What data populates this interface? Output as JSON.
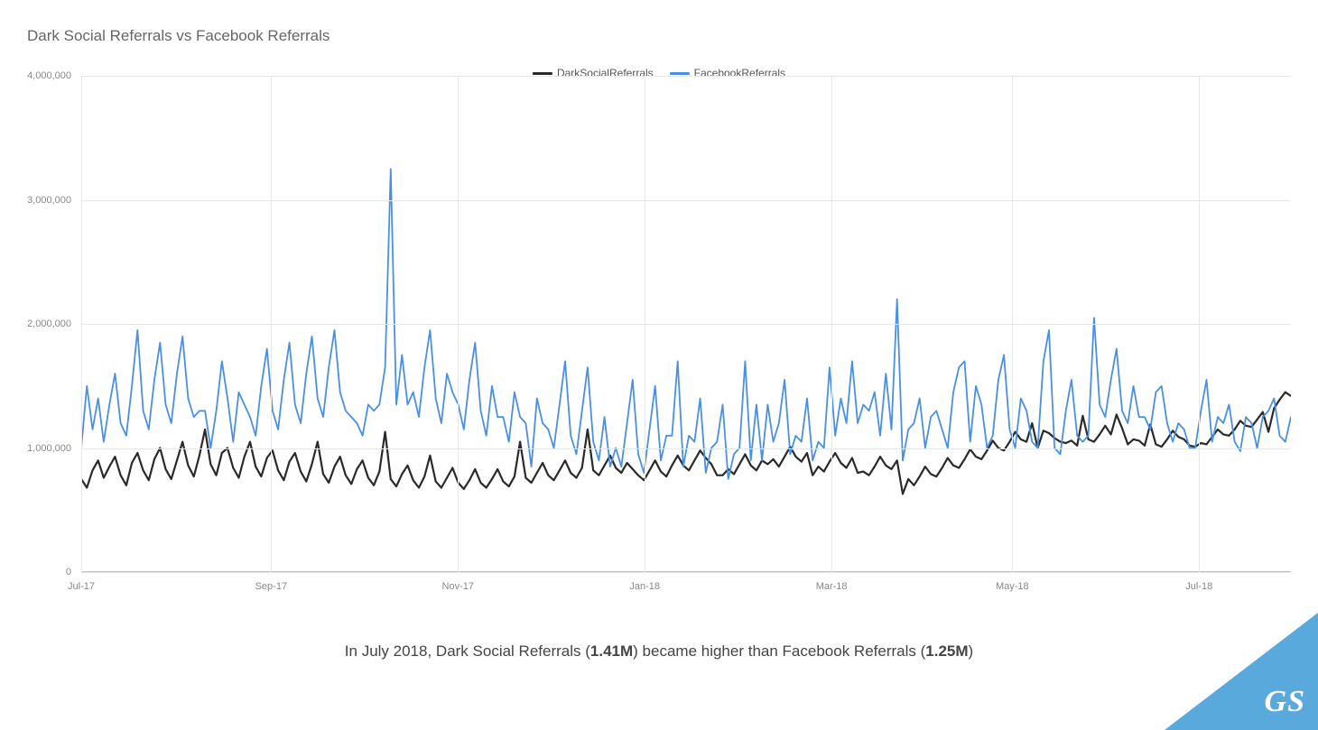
{
  "title": "Dark Social Referrals vs Facebook Referrals",
  "caption": {
    "prefix": "In July 2018, Dark Social Referrals (",
    "val1": "1.41M",
    "mid": ") became higher than Facebook Referrals (",
    "val2": "1.25M",
    "suffix": ")"
  },
  "badge": "GS",
  "colors": {
    "dark_social": "#2a2a2a",
    "facebook": "#4a90e2",
    "badge": "#5aa9dd"
  },
  "chart_data": {
    "type": "line",
    "title": "Dark Social Referrals vs Facebook Referrals",
    "xlabel": "",
    "ylabel": "",
    "ylim": [
      0,
      4000000
    ],
    "x_range_days": 395,
    "y_ticks": [
      0,
      1000000,
      2000000,
      3000000,
      4000000
    ],
    "y_tick_labels": [
      "0",
      "1,000,000",
      "2,000,000",
      "3,000,000",
      "4,000,000"
    ],
    "x_ticks_days": [
      0,
      62,
      123,
      184,
      245,
      304,
      365
    ],
    "x_tick_labels": [
      "Jul-17",
      "Sep-17",
      "Nov-17",
      "Jan-18",
      "Mar-18",
      "May-18",
      "Jul-18"
    ],
    "legend": [
      "DarkSocialReferrals",
      "FacebookReferrals"
    ],
    "series": [
      {
        "name": "DarkSocialReferrals",
        "color": "#2a2a2a",
        "values": [
          750000,
          680000,
          820000,
          900000,
          760000,
          850000,
          930000,
          780000,
          700000,
          880000,
          960000,
          820000,
          740000,
          910000,
          1000000,
          830000,
          750000,
          900000,
          1050000,
          860000,
          770000,
          940000,
          1150000,
          870000,
          780000,
          960000,
          1000000,
          840000,
          760000,
          930000,
          1050000,
          850000,
          770000,
          920000,
          980000,
          820000,
          740000,
          890000,
          960000,
          810000,
          730000,
          870000,
          1050000,
          790000,
          720000,
          850000,
          930000,
          780000,
          710000,
          830000,
          900000,
          760000,
          700000,
          810000,
          1130000,
          750000,
          690000,
          790000,
          860000,
          740000,
          680000,
          770000,
          940000,
          730000,
          680000,
          760000,
          840000,
          720000,
          670000,
          740000,
          830000,
          720000,
          680000,
          750000,
          830000,
          730000,
          690000,
          770000,
          1050000,
          760000,
          720000,
          800000,
          880000,
          780000,
          740000,
          820000,
          900000,
          800000,
          760000,
          840000,
          1150000,
          820000,
          780000,
          860000,
          940000,
          840000,
          800000,
          880000,
          830000,
          780000,
          740000,
          820000,
          900000,
          810000,
          770000,
          860000,
          940000,
          860000,
          820000,
          900000,
          980000,
          920000,
          870000,
          780000,
          780000,
          830000,
          790000,
          870000,
          950000,
          860000,
          820000,
          900000,
          870000,
          910000,
          850000,
          930000,
          1010000,
          930000,
          890000,
          960000,
          780000,
          850000,
          810000,
          890000,
          960000,
          880000,
          840000,
          920000,
          800000,
          810000,
          780000,
          850000,
          930000,
          860000,
          830000,
          900000,
          630000,
          750000,
          700000,
          770000,
          850000,
          790000,
          770000,
          840000,
          920000,
          860000,
          840000,
          910000,
          990000,
          930000,
          910000,
          980000,
          1060000,
          1000000,
          980000,
          1050000,
          1130000,
          1070000,
          1050000,
          1200000,
          1000000,
          1140000,
          1120000,
          1080000,
          1050000,
          1040000,
          1060000,
          1020000,
          1260000,
          1070000,
          1050000,
          1110000,
          1180000,
          1110000,
          1270000,
          1160000,
          1030000,
          1070000,
          1060000,
          1020000,
          1190000,
          1030000,
          1010000,
          1070000,
          1140000,
          1090000,
          1070000,
          1020000,
          1010000,
          1040000,
          1030000,
          1090000,
          1150000,
          1110000,
          1100000,
          1150000,
          1220000,
          1180000,
          1170000,
          1230000,
          1290000,
          1130000,
          1320000,
          1390000,
          1450000,
          1420000
        ]
      },
      {
        "name": "FacebookReferrals",
        "color": "#4a90e2",
        "values": [
          1000000,
          1500000,
          1150000,
          1400000,
          1050000,
          1350000,
          1600000,
          1200000,
          1100000,
          1500000,
          1950000,
          1300000,
          1150000,
          1550000,
          1850000,
          1350000,
          1200000,
          1600000,
          1900000,
          1400000,
          1250000,
          1300000,
          1300000,
          1000000,
          1300000,
          1700000,
          1400000,
          1050000,
          1450000,
          1350000,
          1250000,
          1100000,
          1500000,
          1800000,
          1300000,
          1150000,
          1550000,
          1850000,
          1350000,
          1200000,
          1600000,
          1900000,
          1400000,
          1250000,
          1650000,
          1950000,
          1450000,
          1300000,
          1250000,
          1200000,
          1100000,
          1350000,
          1300000,
          1350000,
          1650000,
          3250000,
          1350000,
          1750000,
          1350000,
          1450000,
          1250000,
          1650000,
          1950000,
          1400000,
          1200000,
          1600000,
          1450000,
          1350000,
          1150000,
          1550000,
          1850000,
          1300000,
          1100000,
          1500000,
          1250000,
          1250000,
          1050000,
          1450000,
          1250000,
          1200000,
          850000,
          1400000,
          1200000,
          1150000,
          1000000,
          1350000,
          1700000,
          1100000,
          950000,
          1300000,
          1650000,
          1050000,
          900000,
          1250000,
          850000,
          1000000,
          850000,
          1200000,
          1550000,
          950000,
          800000,
          1150000,
          1500000,
          900000,
          1100000,
          1100000,
          1700000,
          850000,
          1100000,
          1050000,
          1400000,
          800000,
          1000000,
          1050000,
          1350000,
          750000,
          950000,
          1000000,
          1700000,
          900000,
          1350000,
          900000,
          1350000,
          1050000,
          1200000,
          1550000,
          950000,
          1100000,
          1050000,
          1400000,
          900000,
          1050000,
          1000000,
          1650000,
          1100000,
          1400000,
          1200000,
          1700000,
          1200000,
          1350000,
          1300000,
          1450000,
          1100000,
          1600000,
          1150000,
          2200000,
          900000,
          1150000,
          1200000,
          1400000,
          1000000,
          1250000,
          1300000,
          1150000,
          1000000,
          1450000,
          1650000,
          1700000,
          1050000,
          1500000,
          1350000,
          1000000,
          1100000,
          1550000,
          1750000,
          1150000,
          1000000,
          1400000,
          1300000,
          1050000,
          1000000,
          1700000,
          1950000,
          1000000,
          950000,
          1300000,
          1550000,
          1100000,
          1050000,
          1100000,
          2050000,
          1350000,
          1250000,
          1550000,
          1800000,
          1300000,
          1200000,
          1500000,
          1250000,
          1250000,
          1150000,
          1450000,
          1500000,
          1200000,
          1050000,
          1200000,
          1150000,
          1000000,
          1000000,
          1300000,
          1550000,
          1050000,
          1250000,
          1200000,
          1350000,
          1050000,
          975000,
          1250000,
          1200000,
          1000000,
          1250000,
          1300000,
          1400000,
          1100000,
          1050000,
          1250000
        ]
      }
    ]
  }
}
